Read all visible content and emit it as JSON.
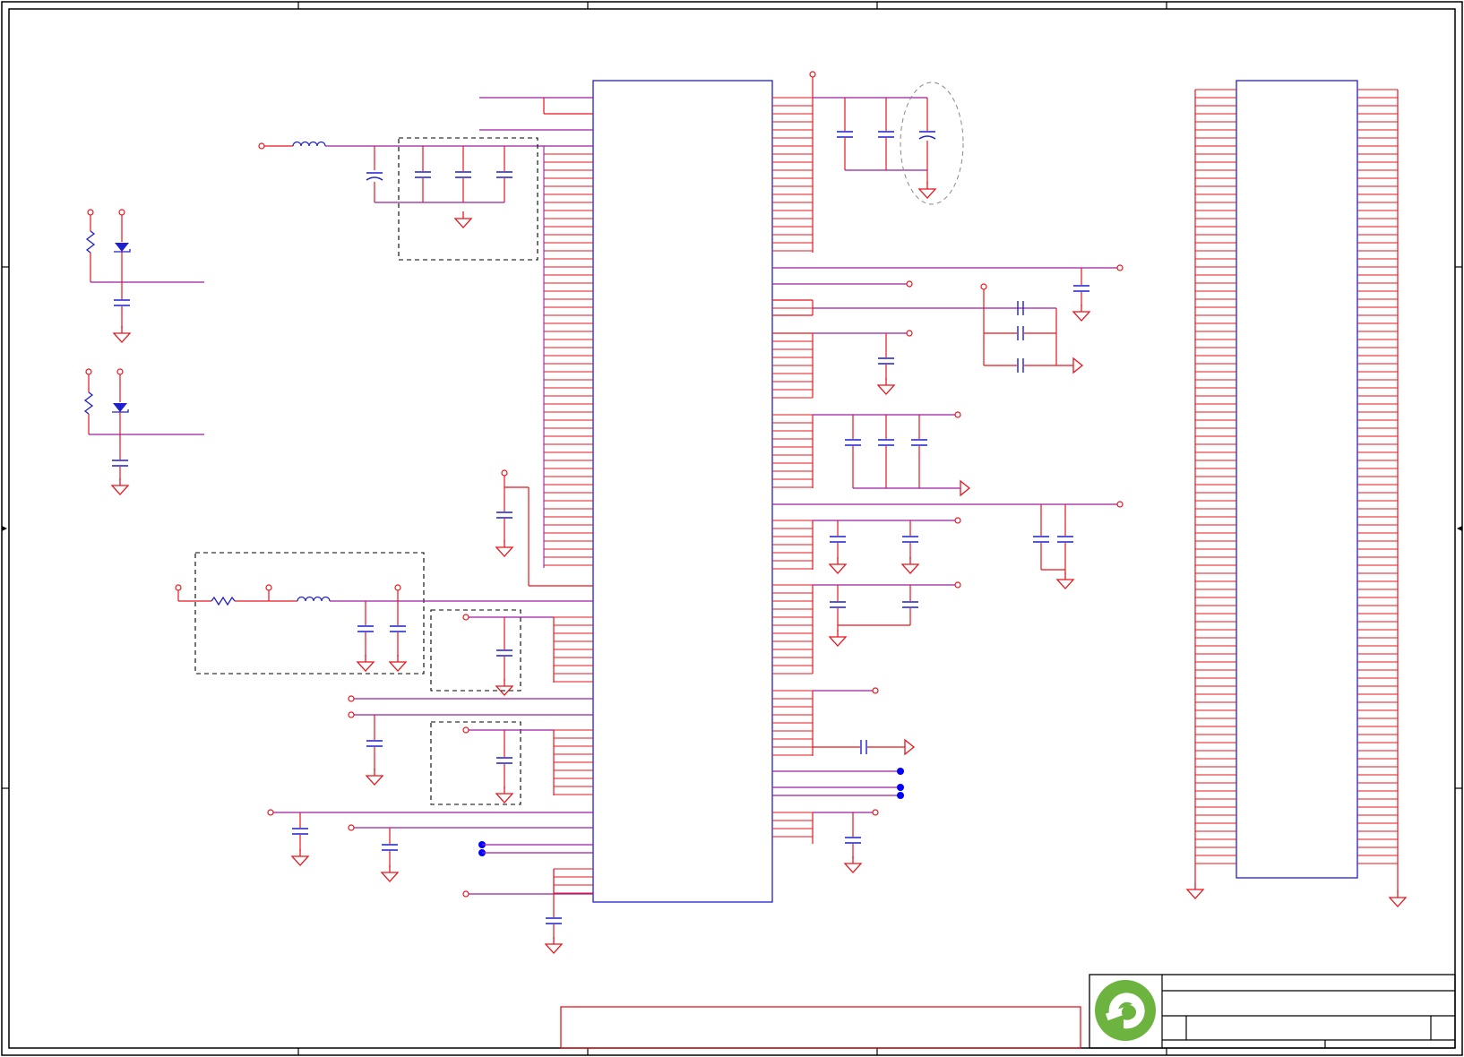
{
  "sheet": {
    "border_color": "#000000",
    "wire_color": "#e8141b",
    "component_color": "#1f1fcf",
    "net_color": "#9c1fa0",
    "dashed_color": "#000000",
    "junction_color": "#0000ff",
    "background": "#ffffff"
  },
  "title_block": {
    "logo": "company-logo-e",
    "logo_color": "#6cb33f"
  }
}
